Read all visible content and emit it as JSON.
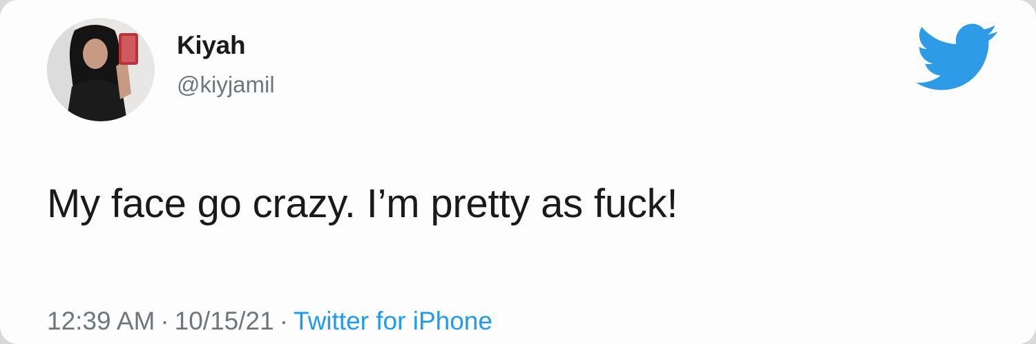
{
  "author": {
    "display_name": "Kiyah",
    "handle": "@kiyjamil"
  },
  "tweet": {
    "text": "My face go crazy. I’m pretty as fuck!",
    "time": "12:39 AM",
    "date": "10/15/21",
    "separator": "·",
    "source": "Twitter for iPhone"
  },
  "icons": {
    "logo": "twitter-bird-icon",
    "avatar": "profile-photo"
  },
  "colors": {
    "accent": "#1d9bf0",
    "text": "#1a1a1a",
    "muted": "#6e767d"
  }
}
